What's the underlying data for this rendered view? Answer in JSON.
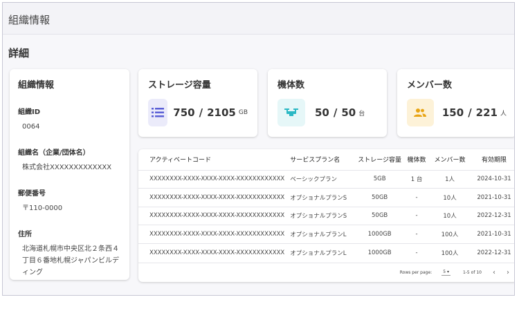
{
  "header": {
    "title": "組織情報"
  },
  "section_title": "詳細",
  "org": {
    "title": "組織情報",
    "fields": [
      {
        "label": "組織ID",
        "value": "0064"
      },
      {
        "label": "組織名（企業/団体名）",
        "value": "株式会社XXXXXXXXXXXXX"
      },
      {
        "label": "郵便番号",
        "value": "〒110-0000"
      },
      {
        "label": "住所",
        "value": "北海道札幌市中央区北２条西４丁目６番地札幌ジャパンビルディング"
      }
    ]
  },
  "stats": [
    {
      "title": "ストレージ容量",
      "used": "750",
      "total": "2105",
      "unit": "GB",
      "icon": "storage-list-icon",
      "color": "#5a5fd6",
      "bg": "#ebebfa"
    },
    {
      "title": "機体数",
      "used": "50",
      "total": "50",
      "unit": "台",
      "icon": "drone-icon",
      "color": "#2bb8c4",
      "bg": "#e6f7f8"
    },
    {
      "title": "メンバー数",
      "used": "150",
      "total": "221",
      "unit": "人",
      "icon": "members-icon",
      "color": "#e8a413",
      "bg": "#fdf2d8"
    }
  ],
  "table": {
    "columns": [
      "アクティベートコード",
      "サービスプラン名",
      "ストレージ容量",
      "機体数",
      "メンバー数",
      "有効期限"
    ],
    "rows": [
      [
        "XXXXXXXX-XXXX-XXXX-XXXX-XXXXXXXXXXXX",
        "ベーシックプラン",
        "5GB",
        "1 台",
        "1人",
        "2024-10-31"
      ],
      [
        "XXXXXXXX-XXXX-XXXX-XXXX-XXXXXXXXXXXX",
        "オプショナルプランS",
        "50GB",
        "-",
        "10人",
        "2021-10-31"
      ],
      [
        "XXXXXXXX-XXXX-XXXX-XXXX-XXXXXXXXXXXX",
        "オプショナルプランS",
        "50GB",
        "-",
        "10人",
        "2022-12-31"
      ],
      [
        "XXXXXXXX-XXXX-XXXX-XXXX-XXXXXXXXXXXX",
        "オプショナルプランL",
        "1000GB",
        "-",
        "100人",
        "2021-10-31"
      ],
      [
        "XXXXXXXX-XXXX-XXXX-XXXX-XXXXXXXXXXXX",
        "オプショナルプランL",
        "1000GB",
        "-",
        "100人",
        "2022-12-31"
      ]
    ],
    "pagination": {
      "rows_label": "Rows per page:",
      "rows_value": "5",
      "range": "1-5 of 10",
      "prev": "‹",
      "next": "›"
    }
  }
}
